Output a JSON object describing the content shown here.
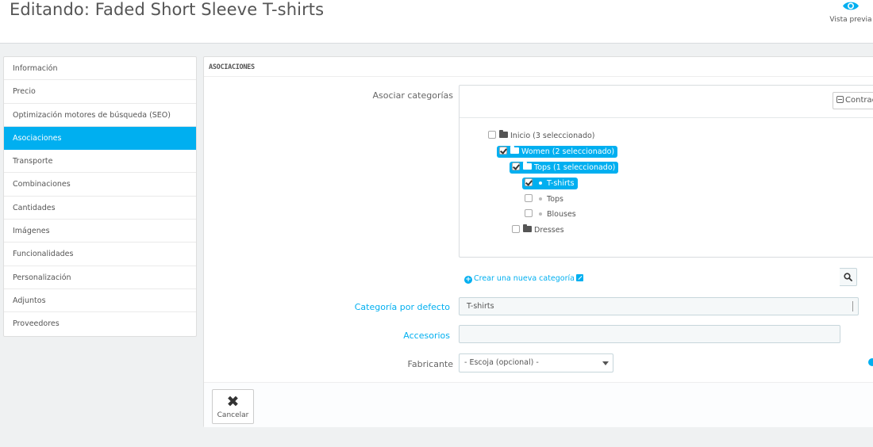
{
  "header": {
    "title": "Editando: Faded Short Sleeve T-shirts",
    "preview_label": "Vista previa",
    "preview_icon": "eye-icon"
  },
  "sidebar": {
    "items": [
      {
        "label": "Información",
        "active": false
      },
      {
        "label": "Precio",
        "active": false
      },
      {
        "label": "Optimización motores de búsqueda (SEO)",
        "active": false
      },
      {
        "label": "Asociaciones",
        "active": true
      },
      {
        "label": "Transporte",
        "active": false
      },
      {
        "label": "Combinaciones",
        "active": false
      },
      {
        "label": "Cantidades",
        "active": false
      },
      {
        "label": "Imágenes",
        "active": false
      },
      {
        "label": "Funcionalidades",
        "active": false
      },
      {
        "label": "Personalización",
        "active": false
      },
      {
        "label": "Adjuntos",
        "active": false
      },
      {
        "label": "Proveedores",
        "active": false
      }
    ]
  },
  "panel": {
    "heading": "ASOCIACIONES",
    "associate_label": "Asociar categorías",
    "collapse_label": "Contraer",
    "tree": [
      {
        "label": "Inicio (3 seleccionado)",
        "checked": false,
        "selected": false,
        "icon": "folder-open-icon"
      },
      {
        "label": "Women (2 seleccionado)",
        "checked": true,
        "selected": true,
        "icon": "folder-open-icon"
      },
      {
        "label": "Tops (1 seleccionado)",
        "checked": true,
        "selected": true,
        "icon": "folder-open-icon"
      },
      {
        "label": "T-shirts",
        "checked": true,
        "selected": true,
        "icon": "dot-icon"
      },
      {
        "label": "Tops",
        "checked": false,
        "selected": false,
        "icon": "dot-icon"
      },
      {
        "label": "Blouses",
        "checked": false,
        "selected": false,
        "icon": "dot-icon"
      },
      {
        "label": "Dresses",
        "checked": false,
        "selected": false,
        "icon": "folder-icon"
      }
    ],
    "create_category_label": "Crear una nueva categoría",
    "default_category_label": "Categoría por defecto",
    "default_category_value": "T-shirts",
    "accessories_label": "Accesorios",
    "accessories_value": "",
    "manufacturer_label": "Fabricante",
    "manufacturer_value": "- Escoja (opcional) -",
    "cancel_label": "Cancelar"
  },
  "colors": {
    "accent": "#00aff0",
    "background": "#eff1f2"
  }
}
